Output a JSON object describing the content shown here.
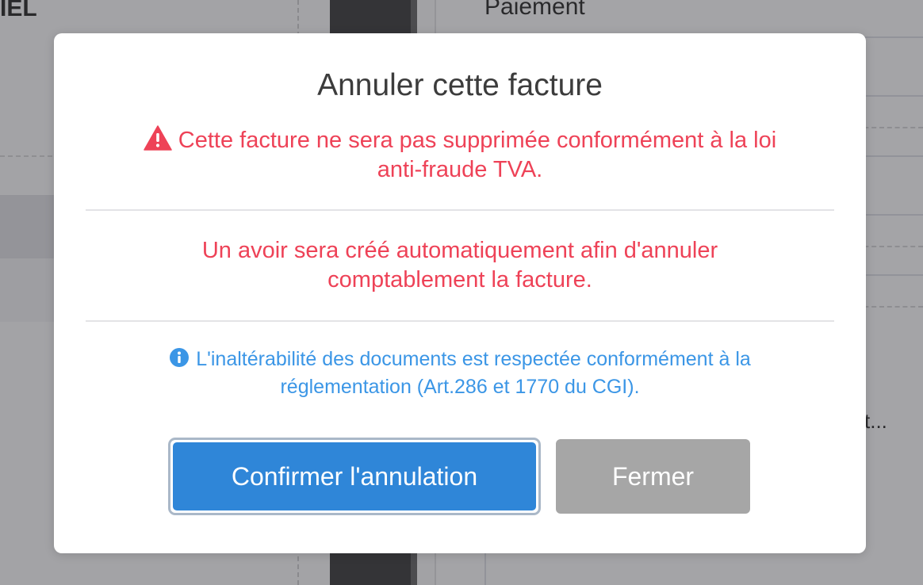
{
  "background": {
    "left_header": "IEL",
    "right_header": "Paiement",
    "right_truncated": "t..."
  },
  "modal": {
    "title": "Annuler cette facture",
    "warning_line1": "Cette facture ne sera pas supprimée conformément à la loi",
    "warning_line2": "anti-fraude TVA.",
    "avoir_line1": "Un avoir sera créé automatiquement afin d'annuler",
    "avoir_line2": "comptablement la facture.",
    "info_line1": "L'inaltérabilité des documents est respectée conformément à la",
    "info_line2": "réglementation (Art.286 et 1770 du CGI).",
    "confirm_label": "Confirmer l'annulation",
    "close_label": "Fermer"
  },
  "colors": {
    "warning": "#ee4257",
    "info": "#3b96e6",
    "primary_button": "#2f86d8",
    "secondary_button": "#a6a6a6"
  },
  "icons": {
    "warning": "warning-triangle-icon",
    "info": "info-circle-icon"
  }
}
